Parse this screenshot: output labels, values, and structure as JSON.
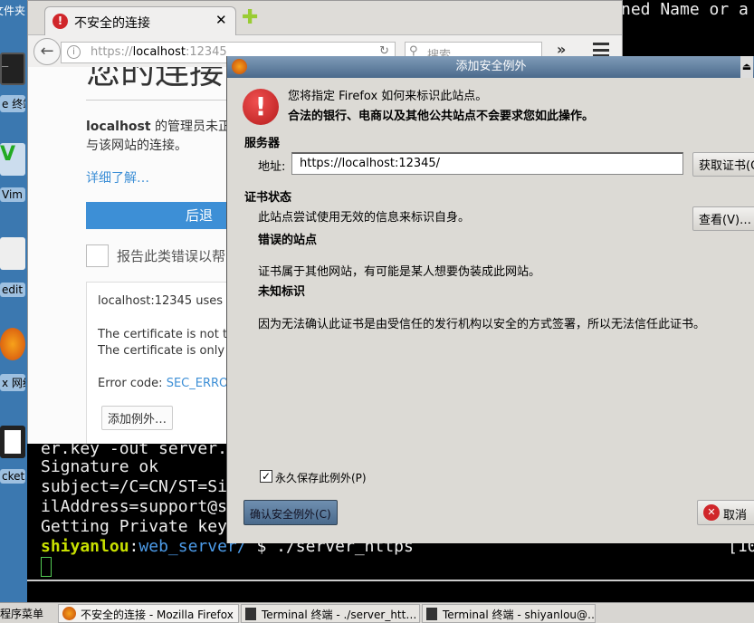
{
  "desktop": {
    "top_label": "文件夹",
    "icons": [
      {
        "label": "e 终端",
        "icon": "terminal-icon"
      },
      {
        "label": "Vim",
        "icon": "vim-icon"
      },
      {
        "label": "edit",
        "icon": "gedit-icon"
      },
      {
        "label": "x 网络",
        "icon": "firefox-icon"
      },
      {
        "label": "ckets",
        "icon": "sockets-icon"
      }
    ]
  },
  "terminal": {
    "top_text": "ned Name or a",
    "lines": [
      "er.key -out server.",
      "Signature ok",
      "subject=/C=CN/ST=Si",
      "ilAddress=support@s",
      "Getting Private key"
    ],
    "prompt_user": "shiyanlou",
    "prompt_sep": ":",
    "prompt_path": "web_server/",
    "prompt_cmd": " $ ./server_https",
    "right_text": "[10"
  },
  "firefox": {
    "tab_title": "不安全的连接",
    "url_scheme": "https://",
    "url_host": "localhost",
    "url_port": ":12345",
    "search_placeholder": "搜索",
    "page": {
      "heading": "您的连接",
      "desc_host": "localhost",
      "desc_rest": " 的管理员未正",
      "desc_line2": "与该网站的连接。",
      "learn_more": "详细了解…",
      "back_button": "后退",
      "report_label": "报告此类错误以帮",
      "adv_line1": "localhost:12345 uses a",
      "adv_line2": "The certificate is not tru",
      "adv_line3": "The certificate is only va",
      "error_code_label": "Error code: ",
      "error_code": "SEC_ERROR",
      "add_exception_button": "添加例外…"
    }
  },
  "dialog": {
    "title": "添加安全例外",
    "intro1": "您将指定 Firefox 如何来标识此站点。",
    "intro2": "合法的银行、电商以及其他公共站点不会要求您如此操作。",
    "server_heading": "服务器",
    "address_label": "地址:",
    "address_value": "https://localhost:12345/",
    "get_cert_button": "获取证书(G)",
    "cert_status_heading": "证书状态",
    "cert_status_text": "此站点尝试使用无效的信息来标识自身。",
    "view_button": "查看(V)…",
    "wrong_site_heading": "错误的站点",
    "wrong_site_text": "证书属于其他网站，有可能是某人想要伪装成此网站。",
    "unknown_heading": "未知标识",
    "unknown_text": "因为无法确认此证书是由受信任的发行机构以安全的方式签署，所以无法信任此证书。",
    "permanent_label": "永久保存此例外(P)",
    "permanent_checked": true,
    "confirm_button": "确认安全例外(C)",
    "cancel_button": "取消"
  },
  "taskbar": {
    "menu": "程序菜单",
    "items": [
      "不安全的连接 - Mozilla Firefox",
      "Terminal 终端 - ./server_htt…",
      "Terminal 终端 - shiyanlou@…"
    ]
  },
  "colors": {
    "accent": "#3d8fd6",
    "prompt_user": "#c8e000",
    "prompt_path": "#4c9be8",
    "warning": "#d0262a"
  }
}
